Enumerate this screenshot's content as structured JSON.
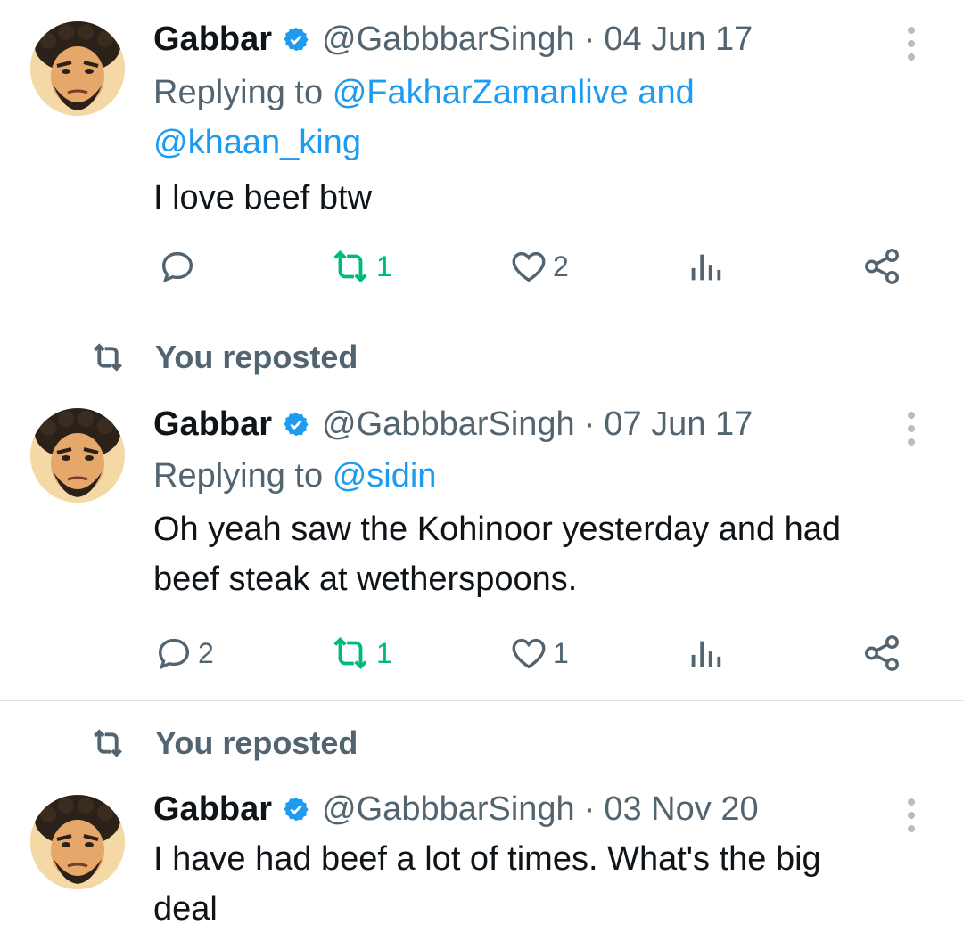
{
  "tweets": [
    {
      "name": "Gabbar",
      "handle": "@GabbbarSingh",
      "separator": "·",
      "date": "04 Jun 17",
      "reposted_label": "",
      "replying_prefix": "Replying to",
      "replying_mention_1": "@FakharZamanlive",
      "replying_and": "and",
      "replying_mention_2": "@khaan_king",
      "text": "I love beef btw",
      "reply_count": "",
      "repost_count": "1",
      "like_count": "2"
    },
    {
      "name": "Gabbar",
      "handle": "@GabbbarSingh",
      "separator": "·",
      "date": "07 Jun 17",
      "reposted_label": "You reposted",
      "replying_prefix": "Replying to",
      "replying_mention_1": "@sidin",
      "text_line_1": "Oh yeah saw the Kohinoor yesterday and had",
      "text_line_2": "beef steak at wetherspoons.",
      "reply_count": "2",
      "repost_count": "1",
      "like_count": "1"
    },
    {
      "name": "Gabbar",
      "handle": "@GabbbarSingh",
      "separator": "·",
      "date": "03 Nov 20",
      "reposted_label": "You reposted",
      "text_line_1": "I have had beef a lot of times. What's the big",
      "text_line_2": "deal"
    }
  ],
  "icons": {
    "verified": "verified-badge-icon",
    "more": "more-vertical-icon",
    "reply": "reply-icon",
    "repost": "repost-icon",
    "like": "heart-icon",
    "views": "views-icon",
    "share": "share-icon"
  },
  "colors": {
    "link": "#1d9bf0",
    "secondary_text": "#536471",
    "repost_active": "#00ba7c",
    "verified": "#1d9bf0"
  }
}
